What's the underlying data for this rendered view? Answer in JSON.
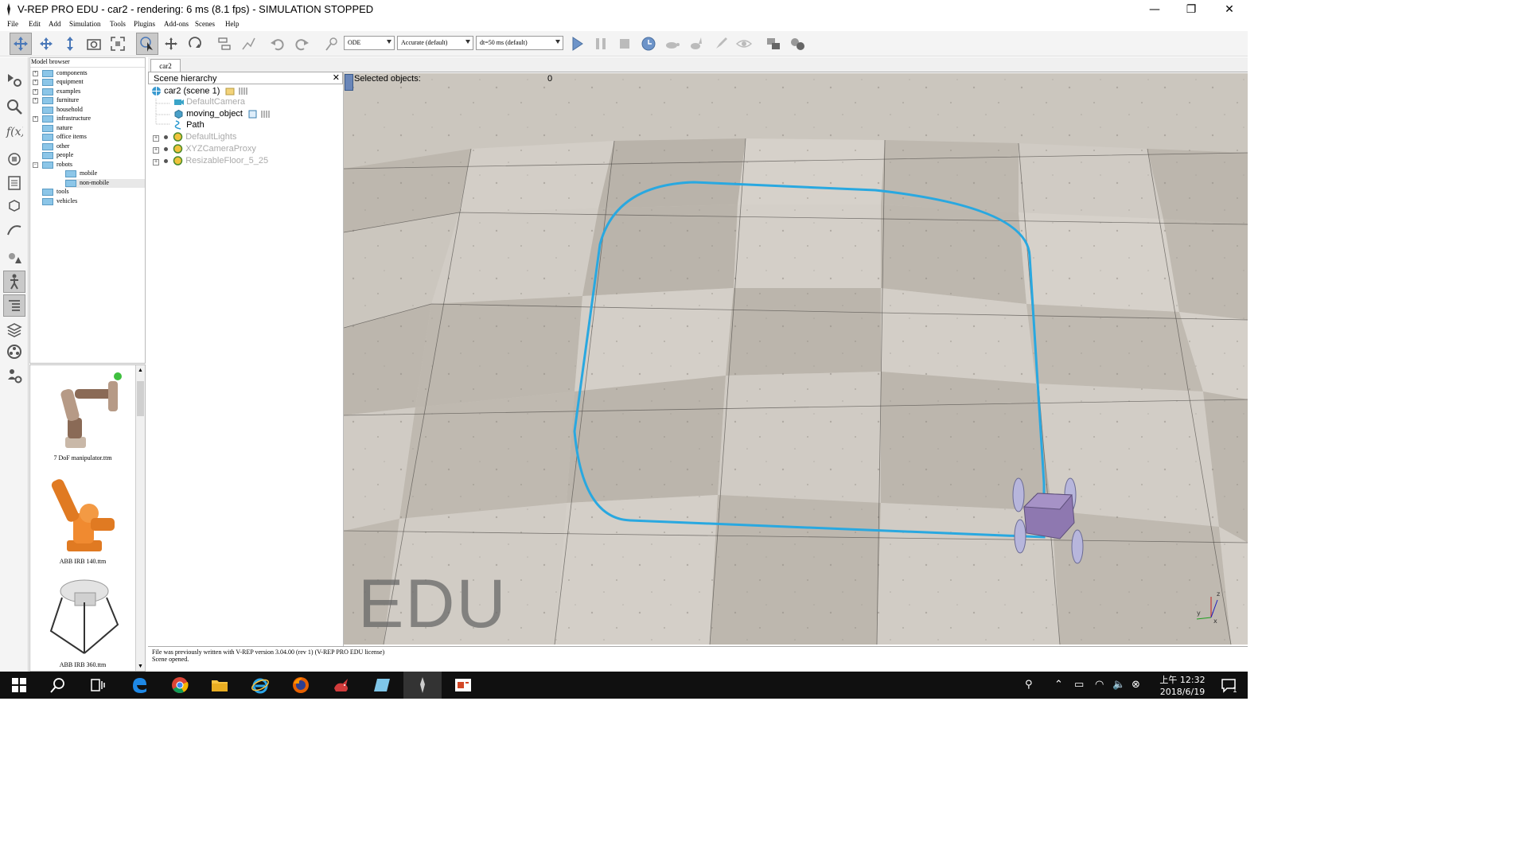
{
  "window": {
    "title": "V-REP PRO EDU - car2 - rendering: 6 ms (8.1 fps) - SIMULATION STOPPED",
    "minimize": "—",
    "maximize": "❐",
    "close": "✕"
  },
  "menu": [
    "File",
    "Edit",
    "Add",
    "Simulation",
    "Tools",
    "Plugins",
    "Add-ons",
    "Scenes",
    "Help"
  ],
  "toolbar": {
    "engine": "ODE",
    "accuracy": "Accurate (default)",
    "timestep": "dt=50 ms (default)"
  },
  "model_browser": {
    "title": "Model browser",
    "items": [
      {
        "label": "components"
      },
      {
        "label": "equipment"
      },
      {
        "label": "examples"
      },
      {
        "label": "furniture"
      },
      {
        "label": "household"
      },
      {
        "label": "infrastructure"
      },
      {
        "label": "nature"
      },
      {
        "label": "office items"
      },
      {
        "label": "other"
      },
      {
        "label": "people"
      },
      {
        "label": "robots"
      },
      {
        "label": "mobile"
      },
      {
        "label": "non-mobile"
      },
      {
        "label": "tools"
      },
      {
        "label": "vehicles"
      }
    ]
  },
  "thumbnails": [
    {
      "label": "7 DoF manipulator.ttm"
    },
    {
      "label": "ABB IRB 140.ttm"
    },
    {
      "label": "ABB IRB 360.ttm"
    }
  ],
  "scene_tab": "car2",
  "hierarchy": {
    "title": "Scene hierarchy",
    "close": "✕",
    "items": [
      {
        "label": "car2 (scene 1)"
      },
      {
        "label": "DefaultCamera"
      },
      {
        "label": "moving_object"
      },
      {
        "label": "Path"
      },
      {
        "label": "DefaultLights"
      },
      {
        "label": "XYZCameraProxy"
      },
      {
        "label": "ResizableFloor_5_25"
      }
    ]
  },
  "viewport": {
    "selected_label": "Selected objects:",
    "selected_count": "0",
    "watermark": "EDU",
    "path_color": "#29a8e0",
    "body_color": "#8e78b0",
    "wheel_color": "#b7b6dc"
  },
  "console": {
    "lines": [
      "File was previously written with V-REP version 3.04.00 (rev 1) (V-REP PRO EDU license)",
      "Scene opened."
    ]
  },
  "taskbar": {
    "clock_ampm": "上午 12:32",
    "clock_date": "2018/6/19",
    "notif_count": "1"
  }
}
